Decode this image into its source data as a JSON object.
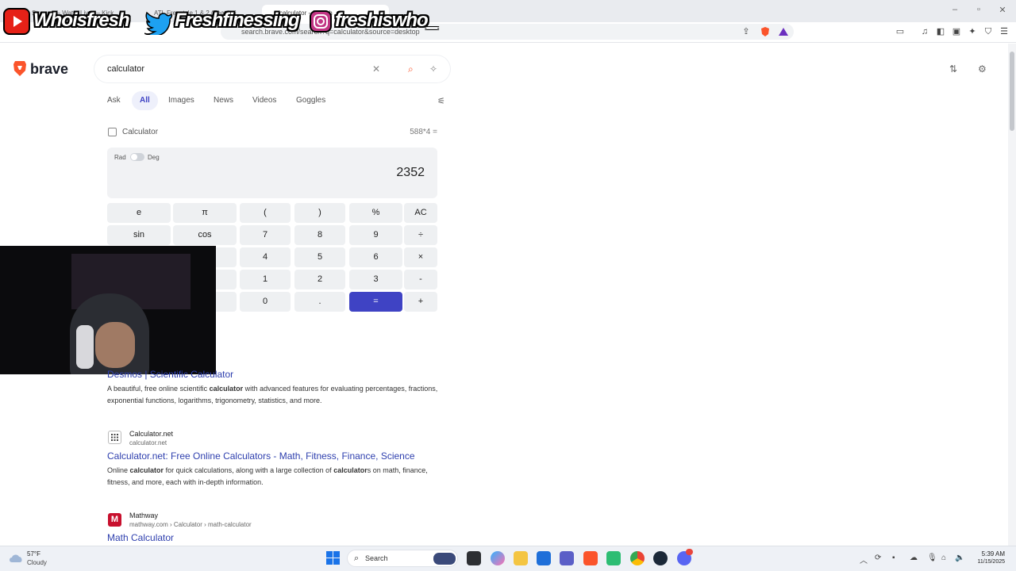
{
  "browser": {
    "tabs": [
      {
        "label": "Stream — Wat... Live — Kick",
        "active": false
      },
      {
        "label": "ATL Freestyle 1 & 2 (Feat Lui",
        "active": false
      },
      {
        "label": "calculator - Search",
        "active": true
      }
    ],
    "url": "search.brave.com/search?q=calculator&source=desktop"
  },
  "overlay": {
    "youtube": "Whoisfresh",
    "twitter": "Freshfinessing",
    "instagram": "freshiswho_",
    "colors": {
      "youtube": "#e62117",
      "twitter": "#1da1f2",
      "instagram": "#c13584"
    }
  },
  "brand": {
    "name": "brave",
    "accent": "#fb542b"
  },
  "search": {
    "query": "calculator"
  },
  "nav": {
    "ask": "Ask",
    "all": "All",
    "images": "Images",
    "news": "News",
    "videos": "Videos",
    "goggles": "Goggles"
  },
  "calculator": {
    "title": "Calculator",
    "expression": "588*4 =",
    "rad": "Rad",
    "deg": "Deg",
    "result": "2352",
    "keys": [
      [
        "e",
        "π",
        "(",
        ")",
        "%",
        "AC"
      ],
      [
        "sin",
        "cos",
        "7",
        "8",
        "9",
        "÷"
      ],
      [
        "",
        "",
        "4",
        "5",
        "6",
        "×"
      ],
      [
        "",
        "",
        "1",
        "2",
        "3",
        "-"
      ],
      [
        "",
        "",
        "0",
        ".",
        "=",
        "+"
      ]
    ]
  },
  "results": [
    {
      "title": "Desmos | Scientific Calculator",
      "desc_parts": [
        "A beautiful, free online scientific ",
        "calculator",
        " with advanced features for evaluating percentages, fractions, exponential functions, logarithms, trigonometry, statistics, and more."
      ]
    },
    {
      "site": "Calculator.net",
      "url": "calculator.net",
      "title": "Calculator.net: Free Online Calculators - Math, Fitness, Finance, Science",
      "desc_parts": [
        "Online ",
        "calculator",
        " for quick calculations, along with a large collection of ",
        "calculator",
        "s on math, finance, fitness, and more, each with in-depth information."
      ]
    },
    {
      "site": "Mathway",
      "url": "mathway.com › Calculator › math-calculator",
      "title": "Math Calculator"
    }
  ],
  "taskbar": {
    "weather_temp": "57°F",
    "weather_desc": "Cloudy",
    "search": "Search",
    "time": "5:39 AM",
    "date": "11/15/2025"
  }
}
